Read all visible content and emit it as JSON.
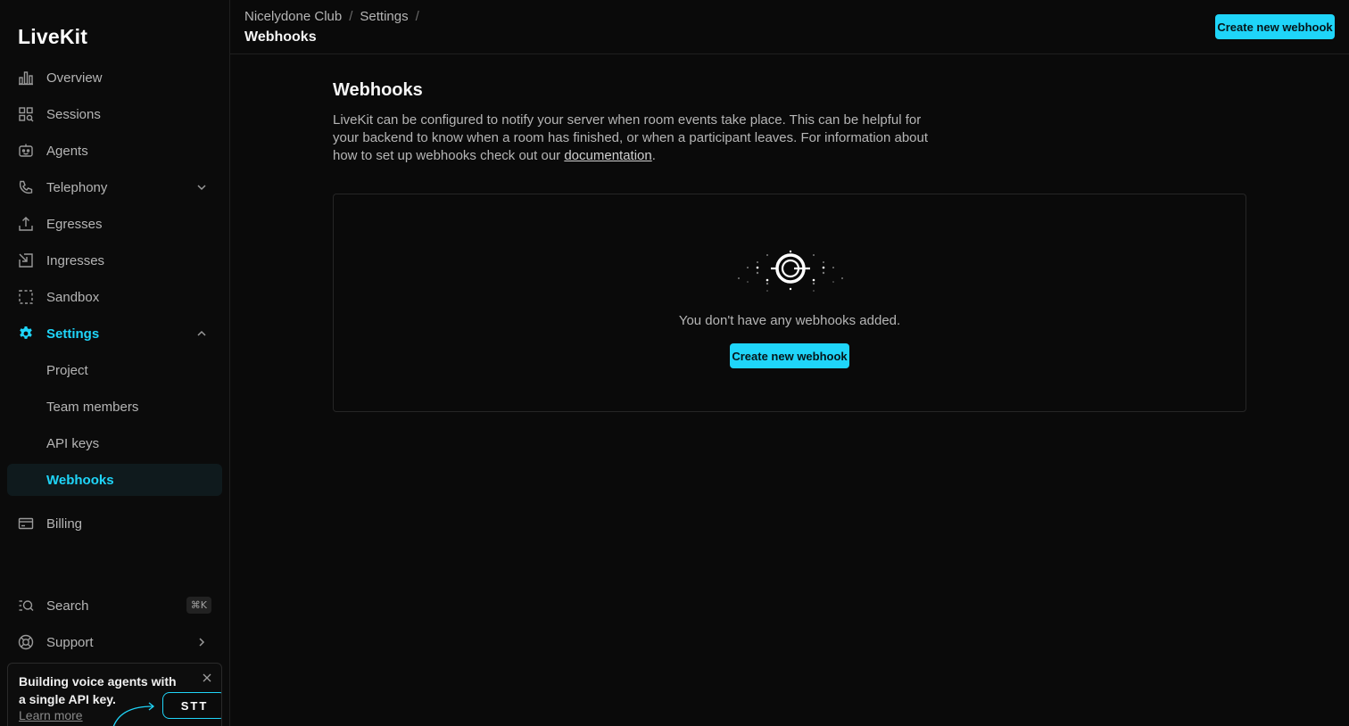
{
  "brand": {
    "logo": "LiveKit",
    "accent": "#1fd5f9"
  },
  "sidebar": {
    "items": [
      {
        "label": "Overview",
        "icon": "bar-chart-icon"
      },
      {
        "label": "Sessions",
        "icon": "grid-search-icon"
      },
      {
        "label": "Agents",
        "icon": "robot-icon"
      },
      {
        "label": "Telephony",
        "icon": "phone-icon"
      },
      {
        "label": "Egresses",
        "icon": "upload-icon"
      },
      {
        "label": "Ingresses",
        "icon": "ingress-icon"
      },
      {
        "label": "Sandbox",
        "icon": "sandbox-icon"
      },
      {
        "label": "Settings",
        "icon": "gear-icon"
      },
      {
        "label": "Billing",
        "icon": "credit-card-icon"
      }
    ],
    "settings_sub": [
      "Project",
      "Team members",
      "API keys",
      "Webhooks"
    ],
    "search": {
      "label": "Search",
      "shortcut": "⌘K"
    },
    "support": {
      "label": "Support"
    },
    "promo": {
      "text": "Building voice agents with a single API key.",
      "link": "Learn more",
      "badge": "STT"
    }
  },
  "header": {
    "breadcrumb": [
      "Nicelydone Club",
      "Settings"
    ],
    "separator": "/",
    "title": "Webhooks",
    "action_label": "Create new webhook"
  },
  "main": {
    "title": "Webhooks",
    "description_before": "LiveKit can be configured to notify your server when room events take place. This can be helpful for your backend to know when a room has finished, or when a participant leaves. For information about how to set up webhooks check out our ",
    "description_link": "documentation",
    "description_after": ".",
    "empty_text": "You don't have any webhooks added.",
    "empty_action": "Create new webhook"
  }
}
